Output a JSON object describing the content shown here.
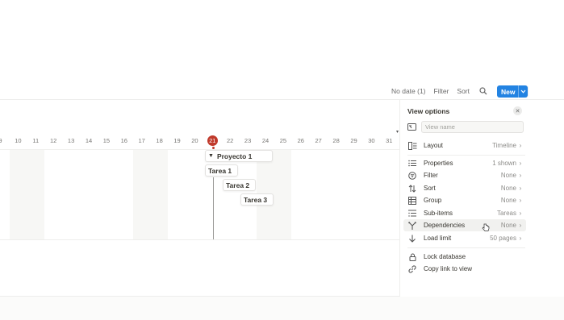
{
  "toolbar": {
    "no_date": "No date (1)",
    "filter": "Filter",
    "sort": "Sort",
    "new": "New"
  },
  "timeline": {
    "days": [
      "9",
      "10",
      "11",
      "12",
      "13",
      "14",
      "15",
      "16",
      "17",
      "18",
      "19",
      "20",
      "21",
      "22",
      "23",
      "24",
      "25",
      "26",
      "27",
      "28",
      "29",
      "30",
      "31"
    ],
    "today": "21",
    "items": [
      {
        "label": "Proyecto 1",
        "group": true
      },
      {
        "label": "Tarea 1"
      },
      {
        "label": "Tarea 2"
      },
      {
        "label": "Tarea 3"
      }
    ]
  },
  "panel": {
    "title": "View options",
    "name_placeholder": "View name",
    "rows": [
      {
        "key": "layout",
        "label": "Layout",
        "value": "Timeline",
        "icon": "layout-icon"
      },
      {
        "key": "properties",
        "label": "Properties",
        "value": "1 shown",
        "icon": "list-icon"
      },
      {
        "key": "filter",
        "label": "Filter",
        "value": "None",
        "icon": "filter-icon"
      },
      {
        "key": "sort",
        "label": "Sort",
        "value": "None",
        "icon": "sort-icon"
      },
      {
        "key": "group",
        "label": "Group",
        "value": "None",
        "icon": "table-icon"
      },
      {
        "key": "subitems",
        "label": "Sub-items",
        "value": "Tareas",
        "icon": "subitems-icon"
      },
      {
        "key": "dependencies",
        "label": "Dependencies",
        "value": "None",
        "icon": "branch-icon"
      },
      {
        "key": "load_limit",
        "label": "Load limit",
        "value": "50 pages",
        "icon": "arrow-down-icon"
      },
      {
        "key": "lock",
        "label": "Lock database",
        "value": "",
        "icon": "lock-icon"
      },
      {
        "key": "copy_link",
        "label": "Copy link to view",
        "value": "",
        "icon": "link-icon"
      }
    ]
  },
  "colors": {
    "accent": "#2383e2",
    "today": "#c0392b"
  }
}
